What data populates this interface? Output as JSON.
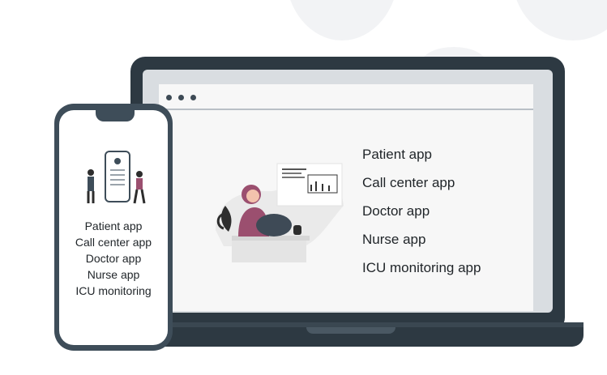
{
  "laptop": {
    "app_list": [
      "Patient app",
      "Call center app",
      "Doctor app",
      "Nurse app",
      "ICU monitoring app"
    ]
  },
  "phone": {
    "app_list": [
      "Patient app",
      "Call center app",
      "Doctor app",
      "Nurse app",
      "ICU monitoring"
    ]
  },
  "colors": {
    "device_frame": "#2d3942",
    "phone_frame": "#3e4d59",
    "accent": "#9b4f6f",
    "background": "#ffffff"
  },
  "icons": [
    "window-dots-icon",
    "person-illustration",
    "plant-illustration",
    "phone-app-illustration"
  ]
}
